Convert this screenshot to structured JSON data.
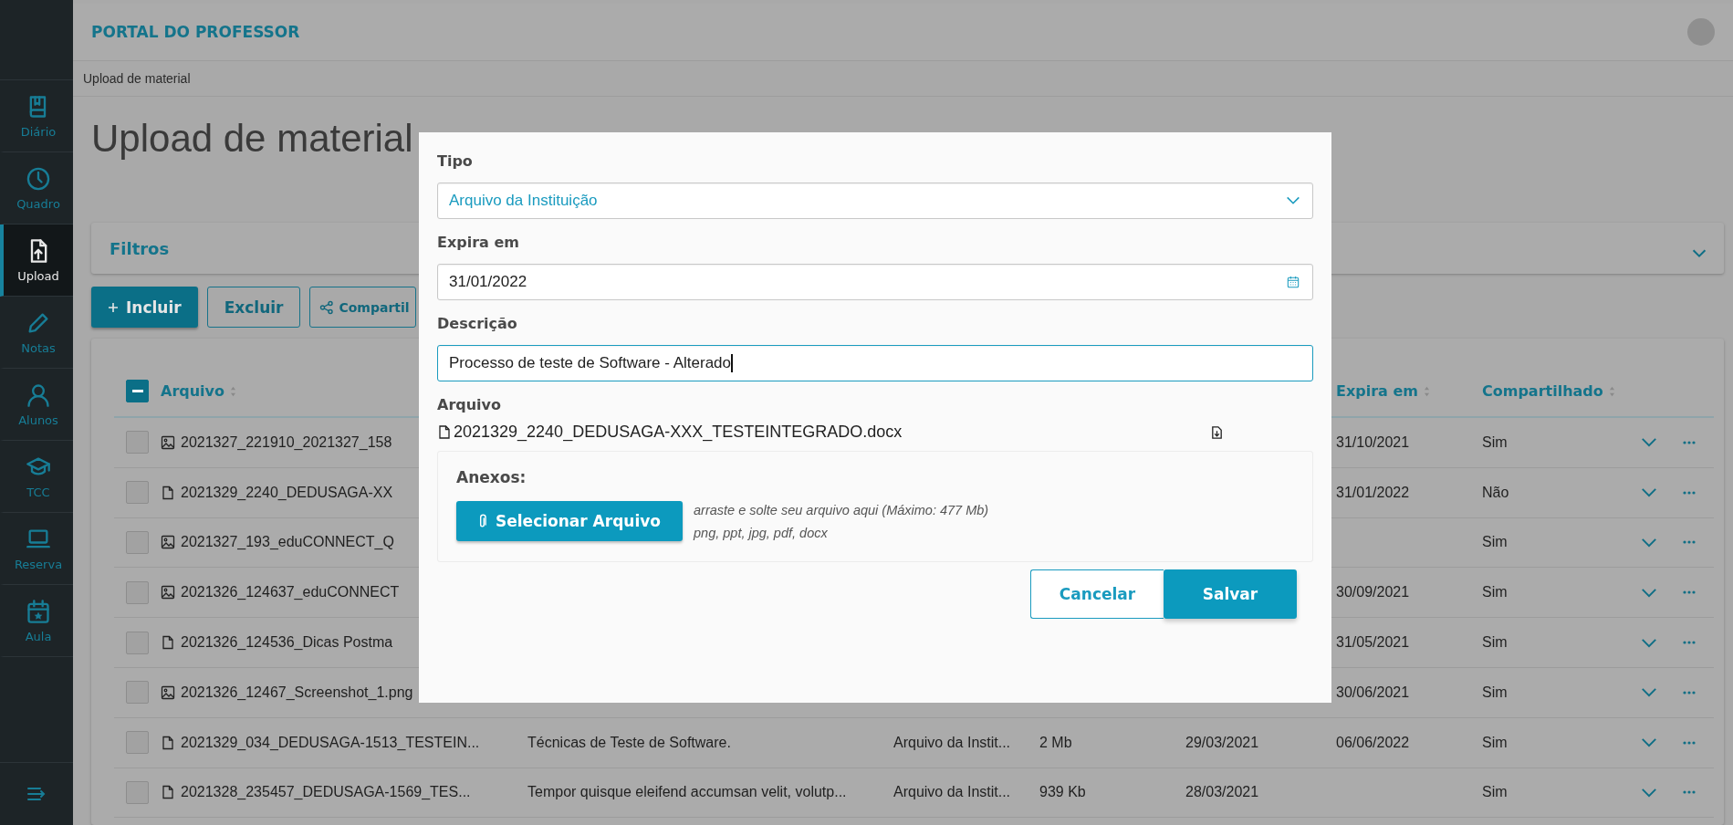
{
  "sidebar": {
    "items": [
      {
        "label": "Diário",
        "selected": false
      },
      {
        "label": "Quadro",
        "selected": false
      },
      {
        "label": "Upload",
        "selected": true
      },
      {
        "label": "Notas",
        "selected": false
      },
      {
        "label": "Alunos",
        "selected": false
      },
      {
        "label": "TCC",
        "selected": false
      },
      {
        "label": "Reserva",
        "selected": false
      },
      {
        "label": "Aula",
        "selected": false
      }
    ]
  },
  "header": {
    "title": "PORTAL DO PROFESSOR"
  },
  "breadcrumb": "Upload de material",
  "page_title": "Upload de material",
  "filters": {
    "title": "Filtros",
    "expanded": false
  },
  "actions": [
    {
      "label": "Incluir",
      "kind": "primary"
    },
    {
      "label": "Excluir",
      "kind": "outline"
    },
    {
      "label": "Compartil",
      "kind": "share"
    }
  ],
  "table": {
    "select_all": {
      "indeterminate": true
    },
    "columns": [
      "Arquivo",
      "Expira em",
      "Compartilhado"
    ],
    "rows": [
      {
        "checked": false,
        "kind": "image",
        "file": "2021327_221910_2021327_158",
        "expires": "31/10/2021",
        "shared": "Sim"
      },
      {
        "checked": false,
        "kind": "document",
        "file": "2021329_2240_DEDUSAGA-XX",
        "expires": "31/01/2022",
        "shared": "Não"
      },
      {
        "checked": false,
        "kind": "image",
        "file": "2021327_193_eduCONNECT_Q",
        "shared": "Sim"
      },
      {
        "checked": false,
        "kind": "image",
        "file": "2021326_124637_eduCONNECT",
        "expires": "30/09/2021",
        "shared": "Sim"
      },
      {
        "checked": false,
        "kind": "document",
        "file": "2021326_124536_Dicas Postma",
        "expires": "31/05/2021",
        "shared": "Sim"
      },
      {
        "checked": false,
        "kind": "image",
        "file": "2021326_12467_Screenshot_1.png",
        "expires": "30/06/2021",
        "shared": "Sim"
      },
      {
        "checked": false,
        "kind": "document",
        "file": "2021329_034_DEDUSAGA-1513_TESTEIN...",
        "description": "Técnicas de Teste de Software.",
        "type": "Arquivo da Instit...",
        "size": "2 Mb",
        "date": "29/03/2021",
        "expires": "06/06/2022",
        "shared": "Sim"
      },
      {
        "checked": false,
        "kind": "document",
        "file": "2021328_235457_DEDUSAGA-1569_TES...",
        "description": "Tempor quisque eleifend accumsan velit, volutp...",
        "type": "Arquivo da Instit...",
        "size": "939 Kb",
        "date": "28/03/2021",
        "shared": "Sim"
      }
    ]
  },
  "dialog": {
    "fields": [
      {
        "label": "Tipo",
        "kind": "select",
        "value": "Arquivo da Instituição",
        "focused": false
      },
      {
        "label": "Expira em",
        "kind": "date",
        "value": "31/01/2022",
        "focused": false
      },
      {
        "label": "Descrição",
        "kind": "text",
        "value": "Processo de teste de Software - Alterado",
        "focused": true
      }
    ],
    "file": {
      "label": "Arquivo",
      "name": "2021329_2240_DEDUSAGA-XXX_TESTEINTEGRADO.docx"
    },
    "attachments": {
      "title": "Anexos:",
      "button": "Selecionar Arquivo",
      "hint": "arraste e solte seu arquivo aqui (Máximo: 477 Mb)",
      "formats": "png, ppt, jpg, pdf, docx"
    },
    "buttons": [
      {
        "label": "Cancelar",
        "kind": "secondary"
      },
      {
        "label": "Salvar",
        "kind": "primary"
      }
    ]
  }
}
